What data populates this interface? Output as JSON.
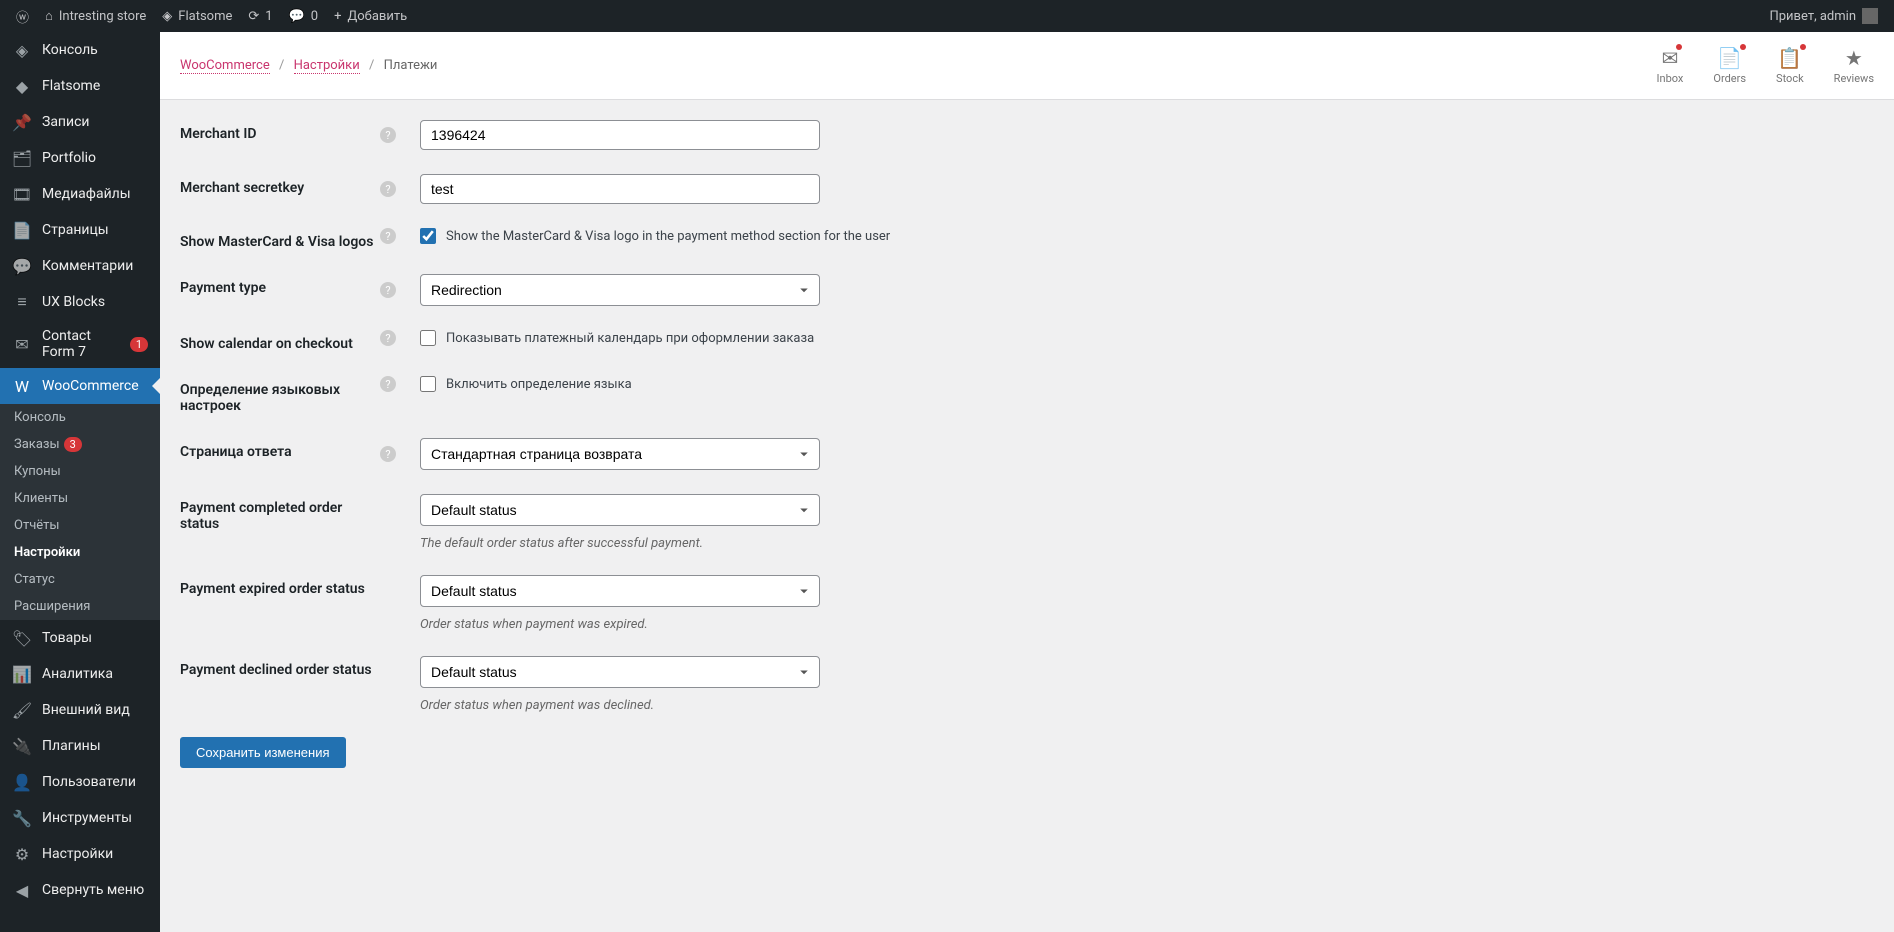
{
  "adminBar": {
    "siteName": "Intresting store",
    "theme": "Flatsome",
    "updates": "1",
    "comments": "0",
    "addNew": "Добавить",
    "greeting": "Привет, admin"
  },
  "sidebar": {
    "items": [
      {
        "icon": "dashboard",
        "label": "Консоль"
      },
      {
        "icon": "flatsome",
        "label": "Flatsome"
      },
      {
        "icon": "pin",
        "label": "Записи"
      },
      {
        "icon": "portfolio",
        "label": "Portfolio"
      },
      {
        "icon": "media",
        "label": "Медиафайлы"
      },
      {
        "icon": "pages",
        "label": "Страницы"
      },
      {
        "icon": "comments",
        "label": "Комментарии"
      },
      {
        "icon": "blocks",
        "label": "UX Blocks"
      },
      {
        "icon": "mail",
        "label": "Contact Form 7",
        "badge": "1"
      },
      {
        "icon": "woo",
        "label": "WooCommerce",
        "active": true
      },
      {
        "icon": "products",
        "label": "Товары"
      },
      {
        "icon": "analytics",
        "label": "Аналитика"
      },
      {
        "icon": "appearance",
        "label": "Внешний вид"
      },
      {
        "icon": "plugins",
        "label": "Плагины"
      },
      {
        "icon": "users",
        "label": "Пользователи"
      },
      {
        "icon": "tools",
        "label": "Инструменты"
      },
      {
        "icon": "settings",
        "label": "Настройки"
      },
      {
        "icon": "collapse",
        "label": "Свернуть меню"
      }
    ],
    "submenu": [
      {
        "label": "Консоль"
      },
      {
        "label": "Заказы",
        "badge": "3"
      },
      {
        "label": "Купоны"
      },
      {
        "label": "Клиенты"
      },
      {
        "label": "Отчёты"
      },
      {
        "label": "Настройки",
        "current": true
      },
      {
        "label": "Статус"
      },
      {
        "label": "Расширения"
      }
    ]
  },
  "breadcrumb": {
    "wc": "WooCommerce",
    "settings": "Настройки",
    "current": "Платежи"
  },
  "headerIcons": {
    "inbox": "Inbox",
    "orders": "Orders",
    "stock": "Stock",
    "reviews": "Reviews"
  },
  "form": {
    "merchantId": {
      "label": "Merchant ID",
      "value": "1396424"
    },
    "merchantSecret": {
      "label": "Merchant secretkey",
      "value": "test"
    },
    "showLogos": {
      "label": "Show MasterCard & Visa logos",
      "text": "Show the MasterCard & Visa logo in the payment method section for the user"
    },
    "paymentType": {
      "label": "Payment type",
      "value": "Redirection"
    },
    "showCalendar": {
      "label": "Show calendar on checkout",
      "text": "Показывать платежный календарь при оформлении заказа"
    },
    "langDetect": {
      "label": "Определение языковых настроек",
      "text": "Включить определение языка"
    },
    "responsePage": {
      "label": "Страница ответа",
      "value": "Стандартная страница возврата"
    },
    "completedStatus": {
      "label": "Payment completed order status",
      "value": "Default status",
      "desc": "The default order status after successful payment."
    },
    "expiredStatus": {
      "label": "Payment expired order status",
      "value": "Default status",
      "desc": "Order status when payment was expired."
    },
    "declinedStatus": {
      "label": "Payment declined order status",
      "value": "Default status",
      "desc": "Order status when payment was declined."
    },
    "submit": "Сохранить изменения"
  }
}
